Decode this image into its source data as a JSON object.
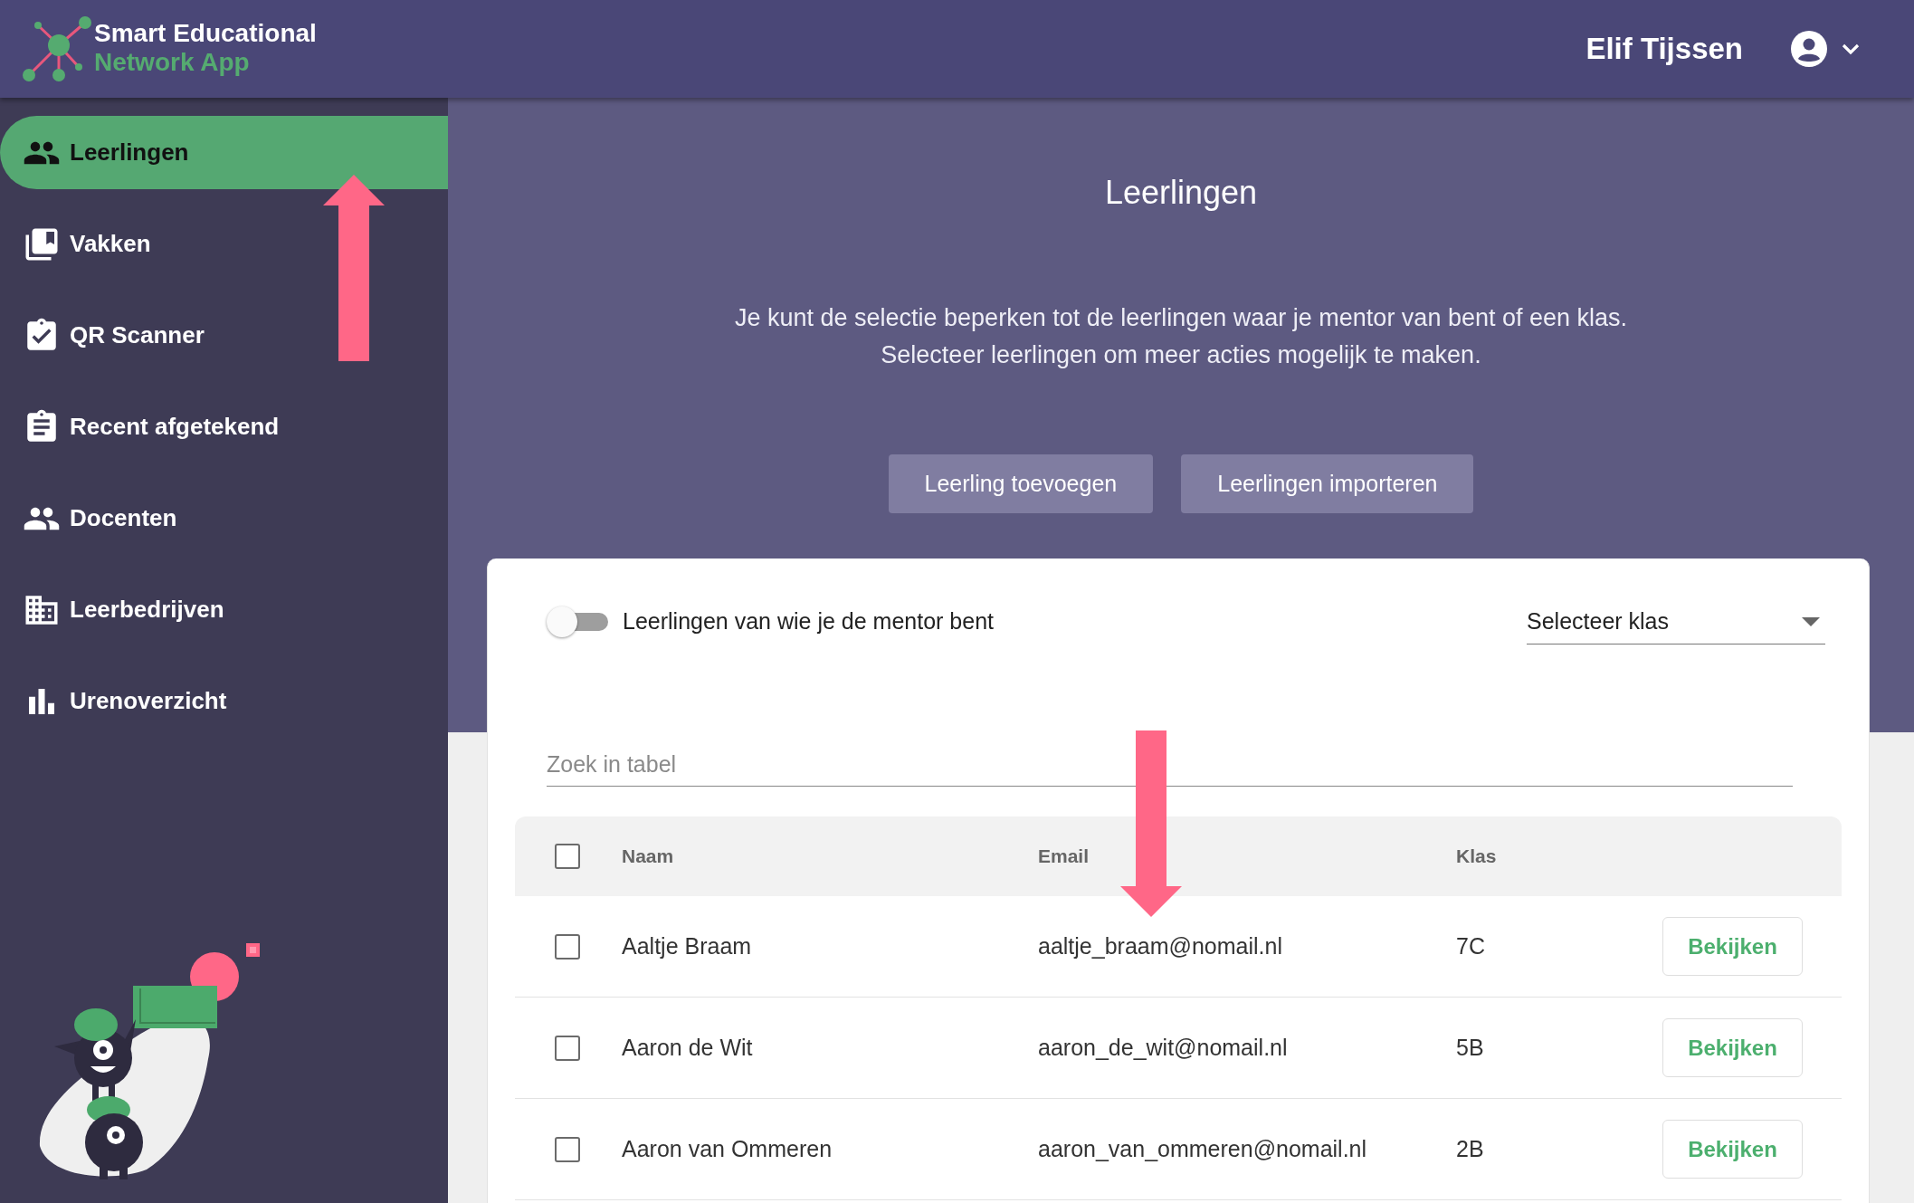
{
  "header": {
    "logo": {
      "lines": [
        "Smart Educational",
        "Network App"
      ]
    },
    "user_name": "Elif Tijssen"
  },
  "sidebar": {
    "items": [
      {
        "label": "Leerlingen",
        "selected": true
      },
      {
        "label": "Vakken",
        "selected": false
      },
      {
        "label": "QR Scanner",
        "selected": false
      },
      {
        "label": "Recent afgetekend",
        "selected": false
      },
      {
        "label": "Docenten",
        "selected": false
      },
      {
        "label": "Leerbedrijven",
        "selected": false
      },
      {
        "label": "Urenoverzicht",
        "selected": false
      }
    ]
  },
  "page": {
    "title": "Leerlingen",
    "description": [
      "Je kunt de selectie beperken tot de leerlingen waar je mentor van bent of een klas.",
      "Selecteer leerlingen om meer acties mogelijk te maken."
    ],
    "buttons": [
      "Leerling toevoegen",
      "Leerlingen importeren"
    ]
  },
  "filters": {
    "mentor_toggle": {
      "label": "Leerlingen van wie je de mentor bent",
      "on": false
    },
    "class_select": {
      "label": "Selecteer klas"
    }
  },
  "search": {
    "placeholder": "Zoek in tabel"
  },
  "table": {
    "select_all": {
      "checked": false
    },
    "columns": [
      "Naam",
      "Email",
      "Klas"
    ],
    "rows": [
      {
        "checked": false,
        "cells": [
          "Aaltje Braam",
          "aaltje_braam@nomail.nl",
          "7C"
        ],
        "action": "Bekijken"
      },
      {
        "checked": false,
        "cells": [
          "Aaron de Wit",
          "aaron_de_wit@nomail.nl",
          "5B"
        ],
        "action": "Bekijken"
      },
      {
        "checked": false,
        "cells": [
          "Aaron van Ommeren",
          "aaron_van_ommeren@nomail.nl",
          "2B"
        ],
        "action": "Bekijken"
      }
    ]
  },
  "annotations": [
    {
      "kind": "up"
    },
    {
      "kind": "down"
    }
  ]
}
